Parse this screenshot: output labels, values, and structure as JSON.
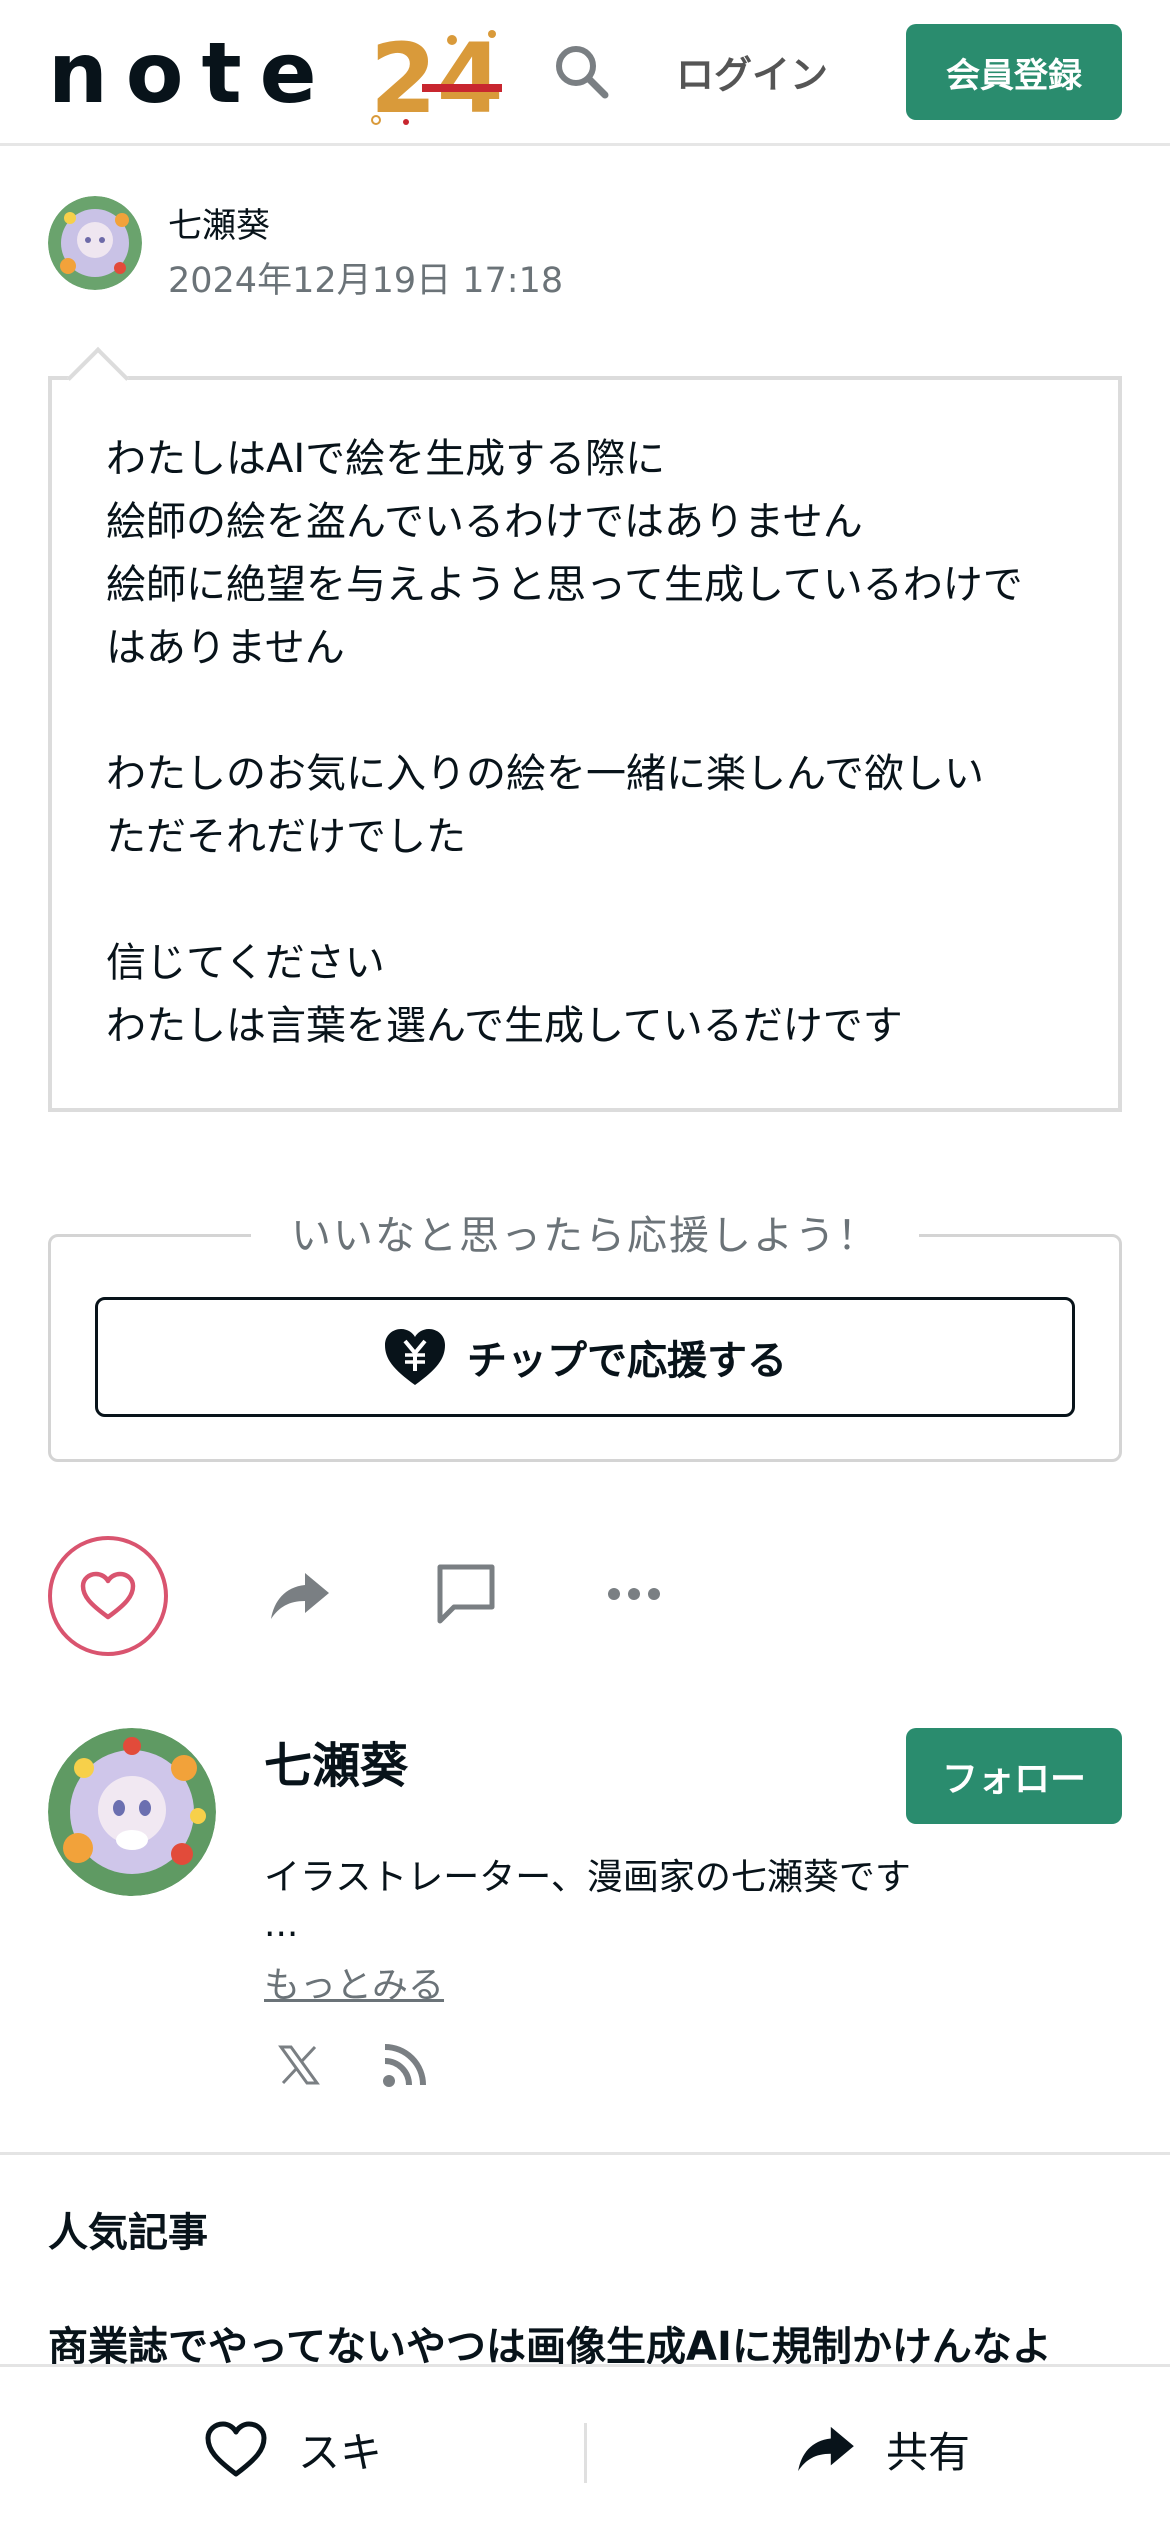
{
  "header": {
    "logo_text": "note",
    "logo_badge": "24",
    "login_label": "ログイン",
    "signup_label": "会員登録"
  },
  "post": {
    "author": "七瀬葵",
    "date": "2024年12月19日 17:18",
    "paragraphs": [
      "わたしはAIで絵を生成する際に\n絵師の絵を盗んでいるわけではありません\n絵師に絶望を与えようと思って生成しているわけで\nはありません",
      "わたしのお気に入りの絵を一緒に楽しんで欲しい\nただそれだけでした",
      "信じてください\nわたしは言葉を選んで生成しているだけです"
    ]
  },
  "support": {
    "label": "いいなと思ったら応援しよう！",
    "tip_button": "チップで応援する"
  },
  "actions": {
    "like_icon": "heart-icon",
    "share_icon": "share-arrow-icon",
    "comment_icon": "comment-icon",
    "more_icon": "more-dots-icon",
    "like_color": "#d9546f"
  },
  "creator": {
    "name": "七瀬葵",
    "follow_label": "フォロー",
    "bio": "イラストレーター、漫画家の七瀬葵です",
    "ellipsis": "...",
    "more_link": "もっとみる",
    "social_icons": [
      "x-icon",
      "rss-icon"
    ]
  },
  "popular": {
    "heading": "人気記事",
    "first_title": "商業誌でやってないやつは画像生成AIに規制かけんなよ"
  },
  "bottom_bar": {
    "like_label": "スキ",
    "share_label": "共有"
  },
  "colors": {
    "accent": "#2a8c6e",
    "text": "#08131a",
    "muted": "#6b7378"
  }
}
